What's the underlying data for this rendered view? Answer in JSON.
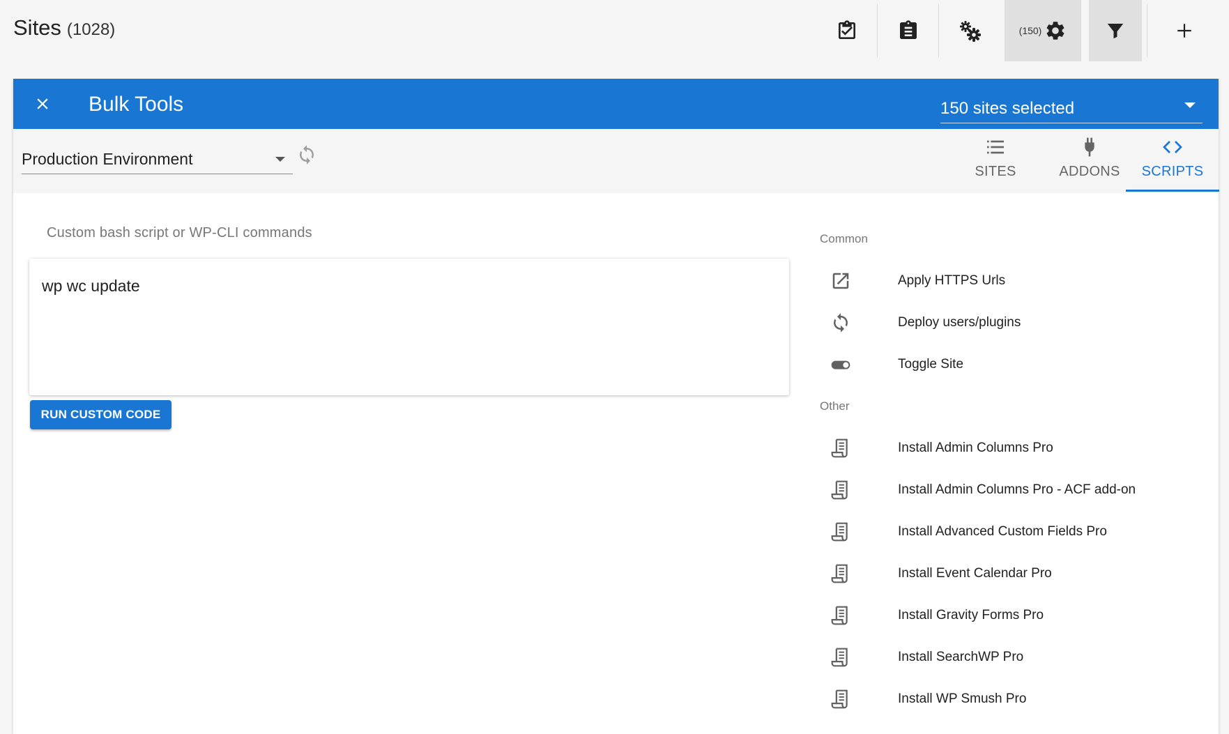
{
  "header": {
    "title": "Sites",
    "count": "(1028)",
    "selected_count": "(150)"
  },
  "bulk": {
    "title": "Bulk Tools",
    "selection": "150 sites selected"
  },
  "environment": {
    "value": "Production Environment"
  },
  "tabs": [
    {
      "label": "SITES",
      "icon": "list-icon"
    },
    {
      "label": "ADDONS",
      "icon": "plug-icon"
    },
    {
      "label": "SCRIPTS",
      "icon": "code-icon"
    }
  ],
  "editor": {
    "label": "Custom bash script or WP-CLI commands",
    "value": "wp wc update",
    "run_label": "RUN CUSTOM CODE"
  },
  "scripts": {
    "common_heading": "Common",
    "common": [
      {
        "label": "Apply HTTPS Urls",
        "icon": "external-link-icon"
      },
      {
        "label": "Deploy users/plugins",
        "icon": "sync-icon"
      },
      {
        "label": "Toggle Site",
        "icon": "toggle-icon"
      }
    ],
    "other_heading": "Other",
    "other": [
      {
        "label": "Install Admin Columns Pro",
        "icon": "script-icon"
      },
      {
        "label": "Install Admin Columns Pro - ACF add-on",
        "icon": "script-icon"
      },
      {
        "label": "Install Advanced Custom Fields Pro",
        "icon": "script-icon"
      },
      {
        "label": "Install Event Calendar Pro",
        "icon": "script-icon"
      },
      {
        "label": "Install Gravity Forms Pro",
        "icon": "script-icon"
      },
      {
        "label": "Install SearchWP Pro",
        "icon": "script-icon"
      },
      {
        "label": "Install WP Smush Pro",
        "icon": "script-icon"
      }
    ]
  },
  "colors": {
    "primary": "#1976d2",
    "background": "#f5f5f5"
  }
}
